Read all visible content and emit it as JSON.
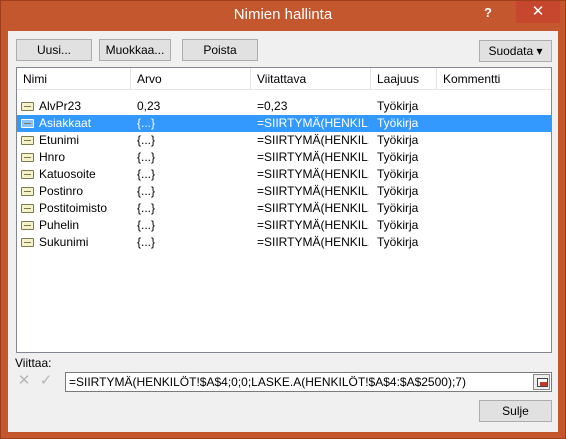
{
  "window": {
    "title": "Nimien hallinta",
    "help": "?",
    "close": "✕"
  },
  "toolbar": {
    "new_label": "Uusi...",
    "edit_label": "Muokkaa...",
    "delete_label": "Poista",
    "filter_label": "Suodata ▾"
  },
  "columns": {
    "name": "Nimi",
    "value": "Arvo",
    "refers_to": "Viitattava",
    "scope": "Laajuus",
    "comment": "Kommentti"
  },
  "rows": [
    {
      "name": "AlvPr23",
      "value": "0,23",
      "refers_to": "=0,23",
      "scope": "Työkirja",
      "comment": "",
      "selected": false
    },
    {
      "name": "Asiakkaat",
      "value": "{...}",
      "refers_to": "=SIIRTYMÄ(HENKIL...",
      "scope": "Työkirja",
      "comment": "",
      "selected": true
    },
    {
      "name": "Etunimi",
      "value": "{...}",
      "refers_to": "=SIIRTYMÄ(HENKIL...",
      "scope": "Työkirja",
      "comment": "",
      "selected": false
    },
    {
      "name": "Hnro",
      "value": "{...}",
      "refers_to": "=SIIRTYMÄ(HENKIL...",
      "scope": "Työkirja",
      "comment": "",
      "selected": false
    },
    {
      "name": "Katuosoite",
      "value": "{...}",
      "refers_to": "=SIIRTYMÄ(HENKIL...",
      "scope": "Työkirja",
      "comment": "",
      "selected": false
    },
    {
      "name": "Postinro",
      "value": "{...}",
      "refers_to": "=SIIRTYMÄ(HENKIL...",
      "scope": "Työkirja",
      "comment": "",
      "selected": false
    },
    {
      "name": "Postitoimisto",
      "value": "{...}",
      "refers_to": "=SIIRTYMÄ(HENKIL...",
      "scope": "Työkirja",
      "comment": "",
      "selected": false
    },
    {
      "name": "Puhelin",
      "value": "{...}",
      "refers_to": "=SIIRTYMÄ(HENKIL...",
      "scope": "Työkirja",
      "comment": "",
      "selected": false
    },
    {
      "name": "Sukunimi",
      "value": "{...}",
      "refers_to": "=SIIRTYMÄ(HENKIL...",
      "scope": "Työkirja",
      "comment": "",
      "selected": false
    }
  ],
  "refers_to_box": {
    "label": "Viittaa:",
    "cancel_glyph": "✕",
    "ok_glyph": "✓",
    "value": "=SIIRTYMÄ(HENKILÖT!$A$4;0;0;LASKE.A(HENKILÖT!$A$4:$A$2500);7)"
  },
  "footer": {
    "close_label": "Sulje"
  },
  "colors": {
    "title_bar": "#c4572d",
    "selection": "#3399ff",
    "close_button": "#c7462e"
  },
  "icons": {
    "name_item": "named-range-icon",
    "collapse": "collapse-dialog-icon"
  }
}
